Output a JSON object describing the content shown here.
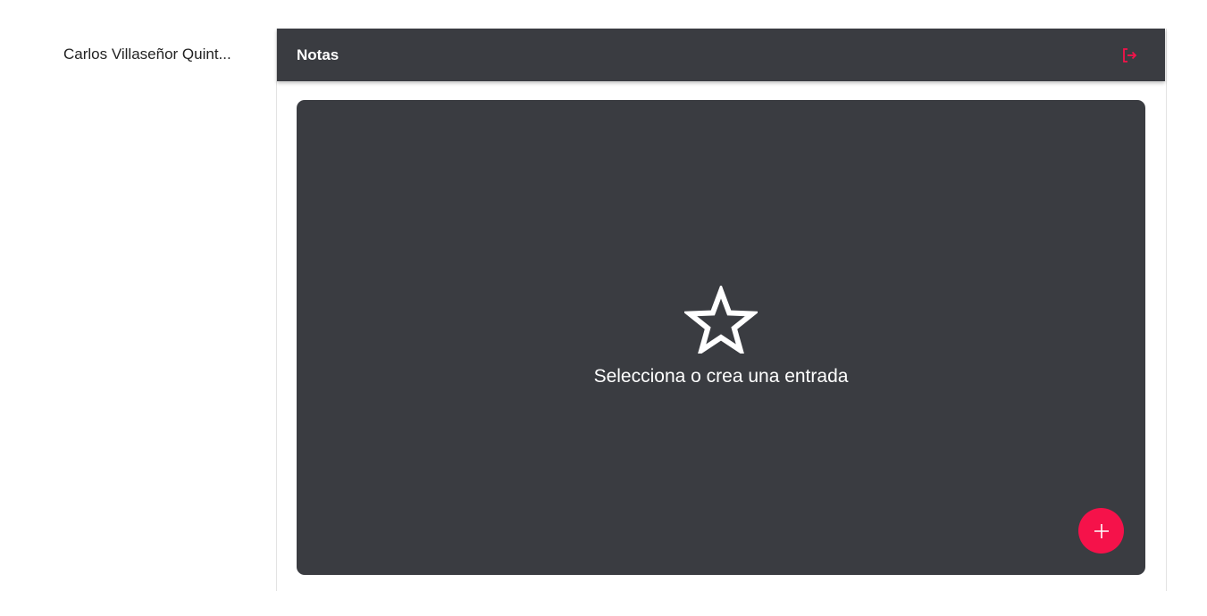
{
  "sidebar": {
    "user_name": "Carlos Villaseñor Quint..."
  },
  "topbar": {
    "title": "Notas",
    "logout_icon": "logout-icon"
  },
  "main": {
    "empty_icon": "star-outline-icon",
    "empty_message": "Selecciona o crea una entrada",
    "add_button_icon": "plus-icon"
  },
  "colors": {
    "panel_bg": "#3a3c41",
    "accent": "#f5124a",
    "text_light": "#ffffff"
  }
}
